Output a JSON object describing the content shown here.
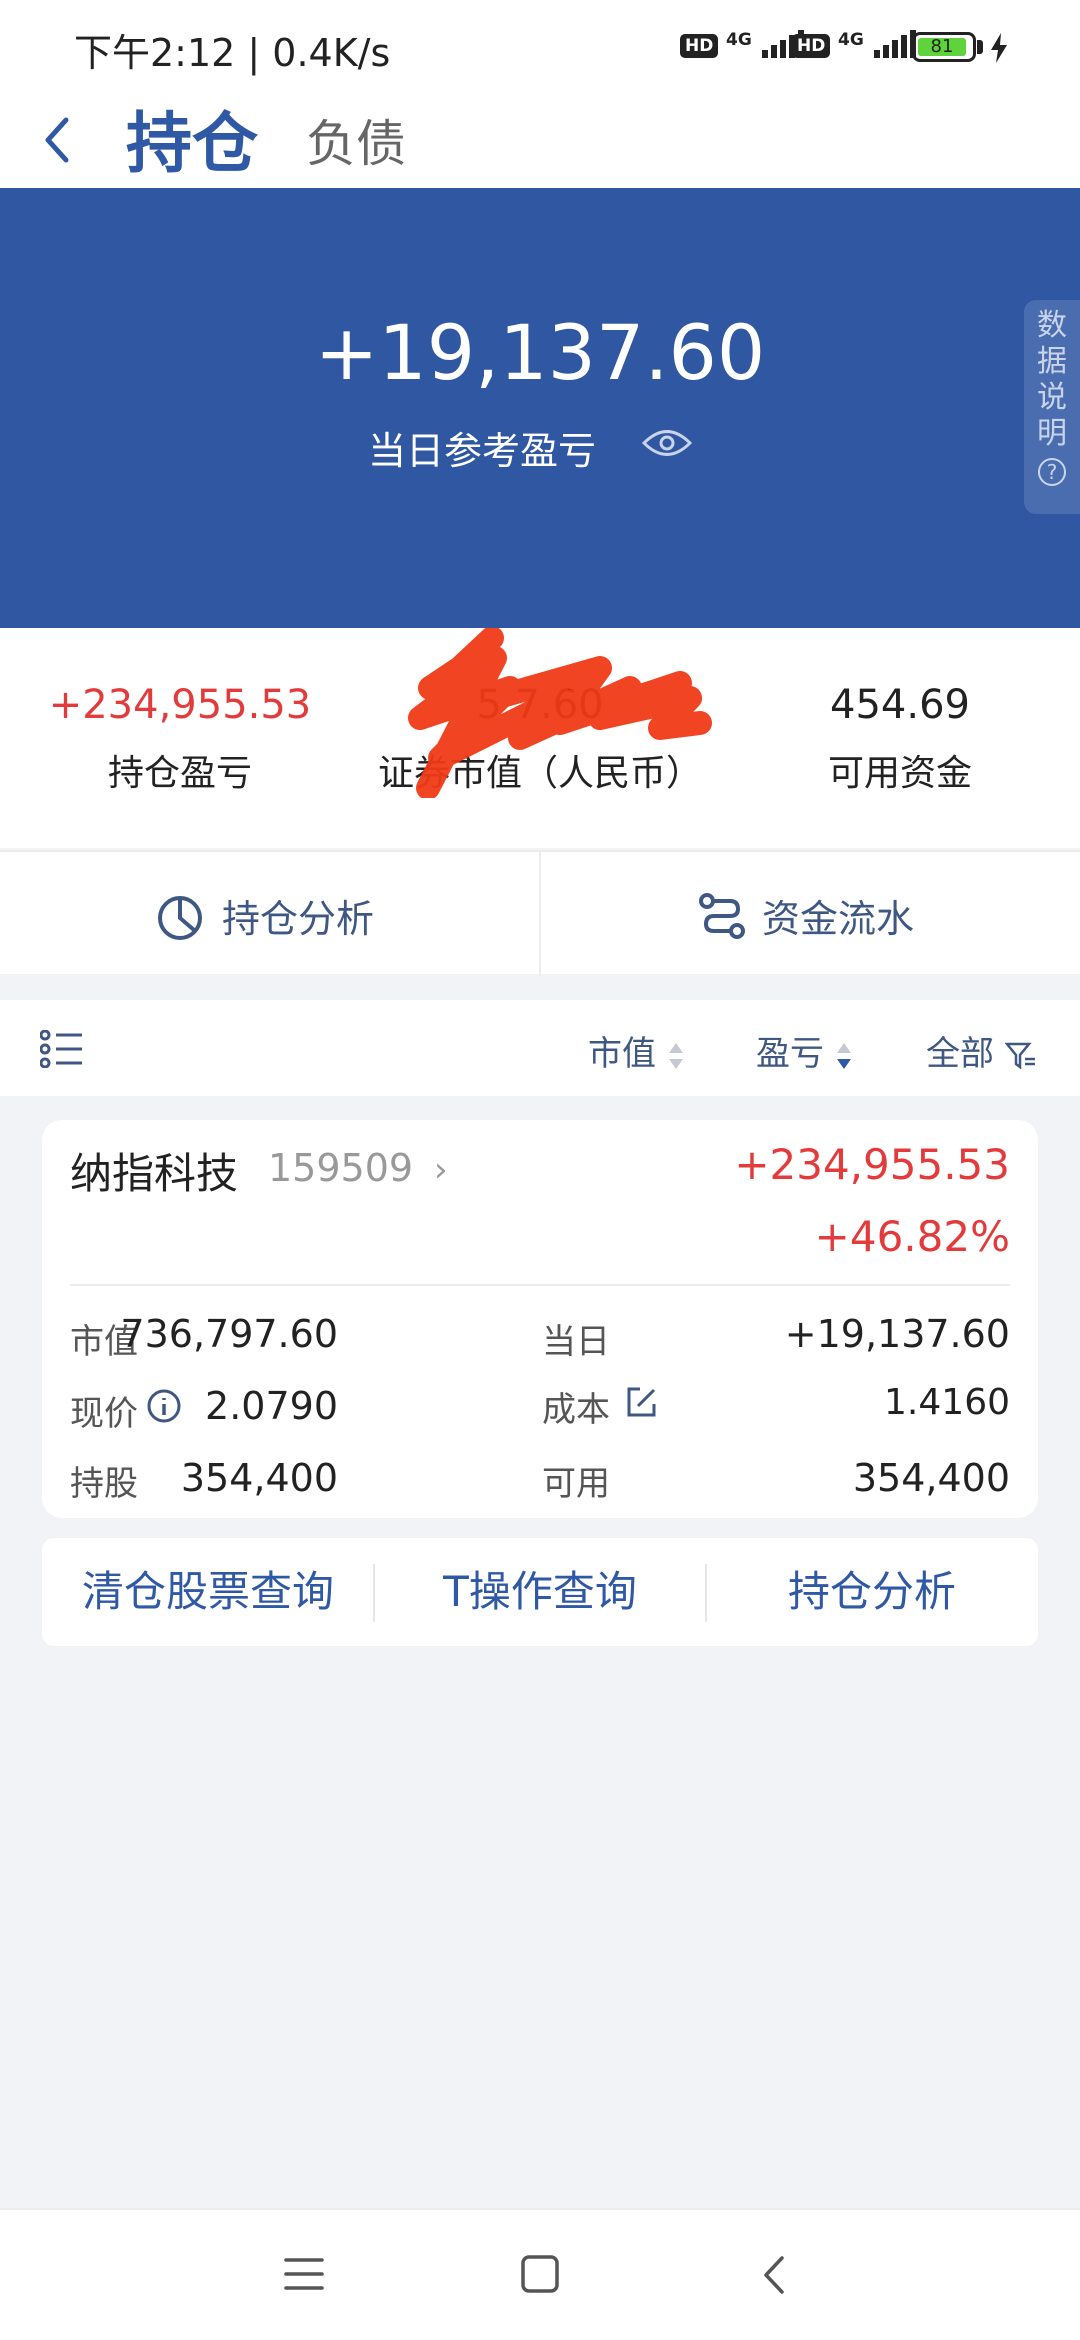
{
  "status_bar": {
    "time_speed": "下午2:12 | 0.4K/s",
    "hd1": "HD",
    "net1": "4G",
    "hd2": "HD",
    "net2": "4G",
    "battery": "81"
  },
  "header": {
    "tab_active": "持仓",
    "tab_other": "负债"
  },
  "banner": {
    "daily_pl": "+19,137.60",
    "daily_pl_label": "当日参考盈亏",
    "side_tab": [
      "数",
      "据",
      "说",
      "明"
    ]
  },
  "stats": {
    "holding_pl": "+234,955.53",
    "holding_pl_label": "持仓盈亏",
    "market_value_partial": "5   7.60",
    "market_value_label": "证券市值（人民币）",
    "available_funds": "454.69",
    "available_funds_label": "可用资金"
  },
  "actions": {
    "analysis": "持仓分析",
    "fund_flow": "资金流水"
  },
  "filters": {
    "market_value": "市值",
    "profit_loss": "盈亏",
    "all": "全部"
  },
  "holding": {
    "name": "纳指科技",
    "code": "159509",
    "pl_amount": "+234,955.53",
    "pl_percent": "+46.82%",
    "market_value_label": "市值",
    "market_value": "736,797.60",
    "daily_label": "当日",
    "daily": "+19,137.60",
    "price_label": "现价",
    "price": "2.0790",
    "cost_label": "成本",
    "cost": "1.4160",
    "shares_label": "持股",
    "shares": "354,400",
    "available_label": "可用",
    "available": "354,400"
  },
  "bottom_buttons": {
    "cleared_query": "清仓股票查询",
    "t_query": "T操作查询",
    "analysis": "持仓分析"
  },
  "colors": {
    "brand_blue": "#2f57a2",
    "profit_red": "#e33b3b",
    "scribble": "#f03a17"
  }
}
